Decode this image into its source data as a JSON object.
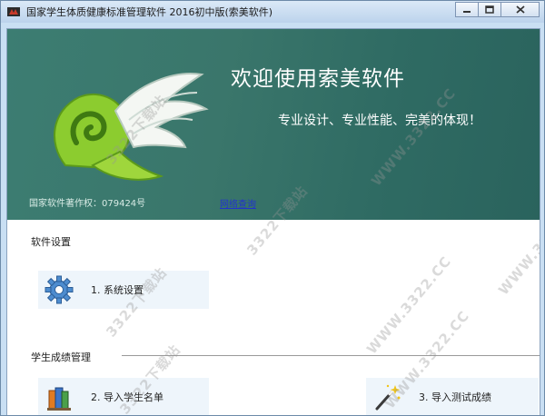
{
  "window": {
    "title": "国家学生体质健康标准管理软件 2016初中版(索美软件)",
    "controls": [
      "minimize-icon",
      "maximize-icon",
      "close-icon"
    ]
  },
  "banner": {
    "welcome": "欢迎使用索美软件",
    "slogan": "专业设计、专业性能、完美的体现！",
    "copyright": "国家软件著作权：079424号",
    "link": "网络查询"
  },
  "sections": {
    "settings": {
      "title": "软件设置",
      "items": [
        {
          "label": "1. 系统设置",
          "icon": "gear-icon"
        }
      ]
    },
    "scores": {
      "title": "学生成绩管理",
      "items": [
        {
          "label": "2. 导入学生名单",
          "icon": "books-icon"
        },
        {
          "label": "3. 导入测试成绩",
          "icon": "magic-wand-icon"
        }
      ]
    }
  },
  "watermarks": [
    "3322下载站",
    "WWW.3322.CC",
    "3322下载站",
    "WWW.3322.CC",
    "3322下载站",
    "WWW.3322.CC",
    "3322下载站",
    "WWW.3322.CC"
  ],
  "colors": {
    "banner": "#3a766b",
    "tile": "#eef5fb",
    "link": "#2233cc"
  }
}
